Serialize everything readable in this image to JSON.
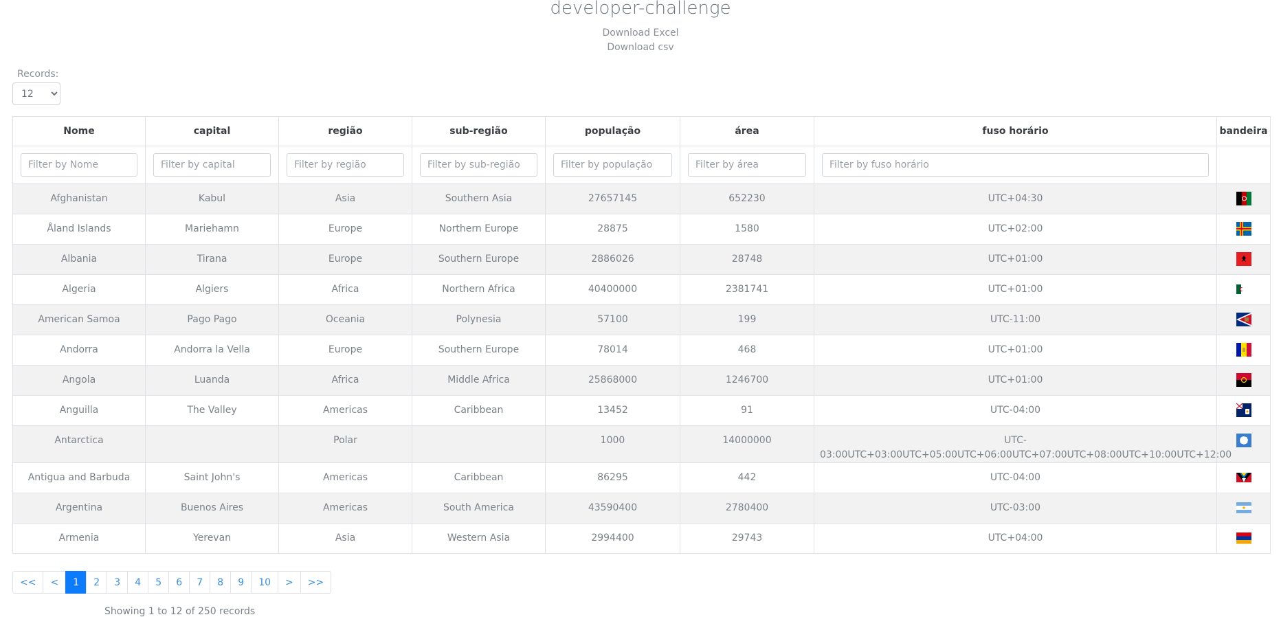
{
  "title": "developer-challenge",
  "downloads": [
    "Download Excel",
    "Download csv"
  ],
  "records": {
    "label": "Records:",
    "value": "12"
  },
  "columns": [
    "Nome",
    "capital",
    "região",
    "sub-região",
    "população",
    "área",
    "fuso horário",
    "bandeira"
  ],
  "filters": [
    "Filter by Nome",
    "Filter by capital",
    "Filter by região",
    "Filter by sub-região",
    "Filter by população",
    "Filter by área",
    "Filter by fuso horário"
  ],
  "rows": [
    {
      "nome": "Afghanistan",
      "capital": "Kabul",
      "regiao": "Asia",
      "subregiao": "Southern Asia",
      "populacao": "27657145",
      "area": "652230",
      "fuso": "UTC+04:30",
      "flag": "afghanistan"
    },
    {
      "nome": "Åland Islands",
      "capital": "Mariehamn",
      "regiao": "Europe",
      "subregiao": "Northern Europe",
      "populacao": "28875",
      "area": "1580",
      "fuso": "UTC+02:00",
      "flag": "aland"
    },
    {
      "nome": "Albania",
      "capital": "Tirana",
      "regiao": "Europe",
      "subregiao": "Southern Europe",
      "populacao": "2886026",
      "area": "28748",
      "fuso": "UTC+01:00",
      "flag": "albania"
    },
    {
      "nome": "Algeria",
      "capital": "Algiers",
      "regiao": "Africa",
      "subregiao": "Northern Africa",
      "populacao": "40400000",
      "area": "2381741",
      "fuso": "UTC+01:00",
      "flag": "algeria"
    },
    {
      "nome": "American Samoa",
      "capital": "Pago Pago",
      "regiao": "Oceania",
      "subregiao": "Polynesia",
      "populacao": "57100",
      "area": "199",
      "fuso": "UTC-11:00",
      "flag": "american-samoa"
    },
    {
      "nome": "Andorra",
      "capital": "Andorra la Vella",
      "regiao": "Europe",
      "subregiao": "Southern Europe",
      "populacao": "78014",
      "area": "468",
      "fuso": "UTC+01:00",
      "flag": "andorra"
    },
    {
      "nome": "Angola",
      "capital": "Luanda",
      "regiao": "Africa",
      "subregiao": "Middle Africa",
      "populacao": "25868000",
      "area": "1246700",
      "fuso": "UTC+01:00",
      "flag": "angola"
    },
    {
      "nome": "Anguilla",
      "capital": "The Valley",
      "regiao": "Americas",
      "subregiao": "Caribbean",
      "populacao": "13452",
      "area": "91",
      "fuso": "UTC-04:00",
      "flag": "anguilla"
    },
    {
      "nome": "Antarctica",
      "capital": "",
      "regiao": "Polar",
      "subregiao": "",
      "populacao": "1000",
      "area": "14000000",
      "fuso": "UTC-03:00UTC+03:00UTC+05:00UTC+06:00UTC+07:00UTC+08:00UTC+10:00UTC+12:00",
      "flag": "antarctica"
    },
    {
      "nome": "Antigua and Barbuda",
      "capital": "Saint John's",
      "regiao": "Americas",
      "subregiao": "Caribbean",
      "populacao": "86295",
      "area": "442",
      "fuso": "UTC-04:00",
      "flag": "antigua"
    },
    {
      "nome": "Argentina",
      "capital": "Buenos Aires",
      "regiao": "Americas",
      "subregiao": "South America",
      "populacao": "43590400",
      "area": "2780400",
      "fuso": "UTC-03:00",
      "flag": "argentina"
    },
    {
      "nome": "Armenia",
      "capital": "Yerevan",
      "regiao": "Asia",
      "subregiao": "Western Asia",
      "populacao": "2994400",
      "area": "29743",
      "fuso": "UTC+04:00",
      "flag": "armenia"
    }
  ],
  "pagination": {
    "pages": [
      "<<",
      "<",
      "1",
      "2",
      "3",
      "4",
      "5",
      "6",
      "7",
      "8",
      "9",
      "10",
      ">",
      ">>"
    ],
    "active": "1",
    "accent": "#0d7bfd"
  },
  "status": "Showing 1 to 12 of 250 records"
}
